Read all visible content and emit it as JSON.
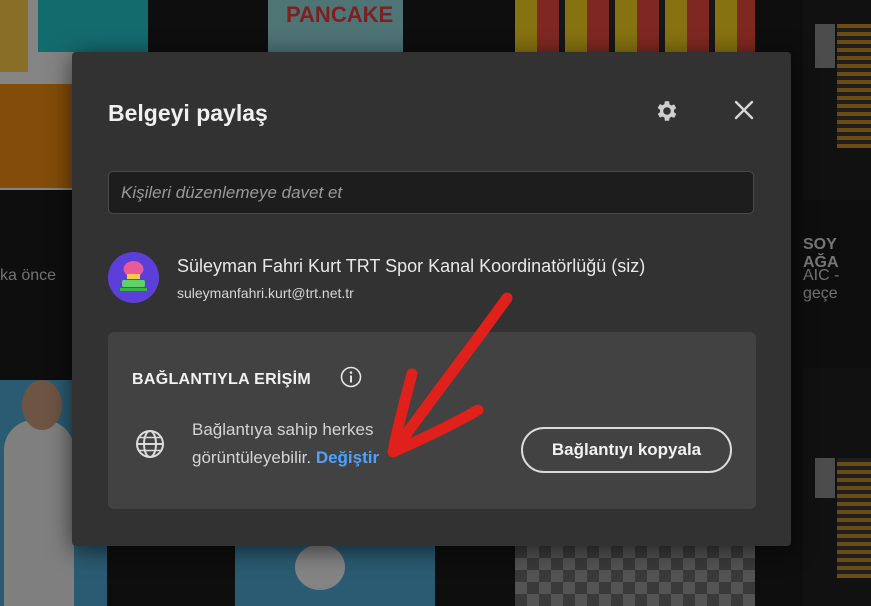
{
  "background": {
    "left_caption": "ka önce",
    "right_title": "SOY AĞA",
    "right_caption": "AIC - geçe",
    "pancake_label": "PANCAKE"
  },
  "dialog": {
    "title": "Belgeyi paylaş",
    "invite_placeholder": "Kişileri düzenlemeye davet et",
    "owner": {
      "name": "Süleyman Fahri Kurt TRT Spor Kanal Koordinatörlüğü (siz)",
      "email": "suleymanfahri.kurt@trt.net.tr"
    },
    "access": {
      "title": "BAĞLANTIYLA ERİŞİM",
      "description": "Bağlantıya sahip herkes görüntüleyebilir.",
      "change_label": "Değiştir",
      "copy_label": "Bağlantıyı kopyala"
    }
  },
  "colors": {
    "dialog_bg": "#323232",
    "access_bg": "#424242",
    "link": "#4aa3ff",
    "annotation": "#e0201b"
  }
}
